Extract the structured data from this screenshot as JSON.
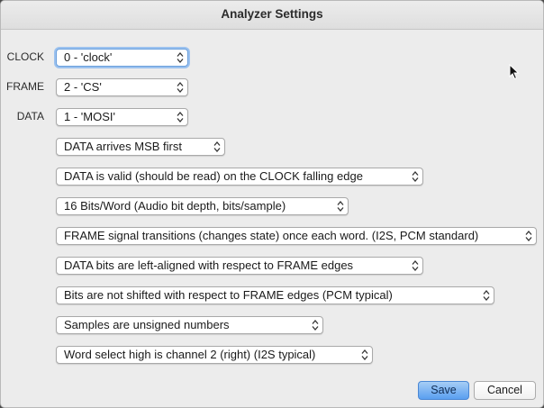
{
  "window": {
    "title": "Analyzer Settings"
  },
  "channels": {
    "clock_label": "CLOCK",
    "clock_value": "0 - 'clock'",
    "frame_label": "FRAME",
    "frame_value": "2 - 'CS'",
    "data_label": "DATA",
    "data_value": "1 - 'MOSI'"
  },
  "options": {
    "bit_order": "DATA arrives MSB first",
    "clock_edge": "DATA is valid (should be read) on the CLOCK falling edge",
    "bits_per_word": "16 Bits/Word (Audio bit depth, bits/sample)",
    "frame_type": "FRAME signal transitions (changes state) once each word. (I2S, PCM standard)",
    "alignment": "DATA bits are left-aligned with respect to FRAME edges",
    "shift": "Bits are not shifted with respect to FRAME edges (PCM typical)",
    "signedness": "Samples are unsigned numbers",
    "word_select": "Word select high is channel 2 (right) (I2S typical)"
  },
  "buttons": {
    "save": "Save",
    "cancel": "Cancel"
  },
  "colors": {
    "accent": "#5a9ff0",
    "focus_ring": "#9cc2ef",
    "window_bg": "#ececec"
  },
  "icons": {
    "select_arrows": "chevron-up-down-icon",
    "cursor": "mouse-pointer-icon"
  }
}
